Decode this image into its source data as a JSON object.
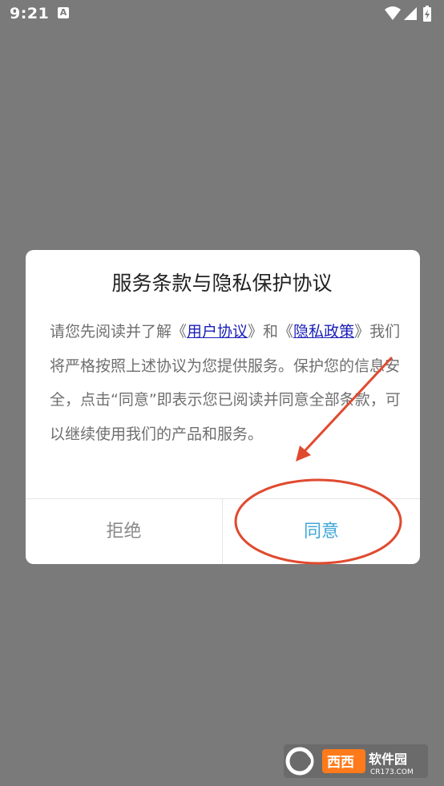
{
  "status_bar": {
    "time": "9:21",
    "notification_icon": "a-icon",
    "wifi_icon": "wifi-icon",
    "signal_icon": "signal-icon",
    "battery_icon": "battery-charging-icon"
  },
  "dialog": {
    "title": "服务条款与隐私保护协议",
    "body": {
      "text_1": "请您先阅读并了解《",
      "link_user_agreement": "用户协议",
      "text_2": "》和《",
      "link_privacy_policy_line1": "隐私政",
      "link_privacy_policy_line2": "策",
      "text_3": "》我们将严格按照上述协议为您提供服务。保护您的信息安全，点击“同意”即表示您已阅读并同意全部条款，可以继续使用我们的产品和服务。"
    },
    "buttons": {
      "refuse": "拒绝",
      "agree": "同意"
    }
  },
  "colors": {
    "backdrop": "#7a7a7a",
    "dialog_bg": "#ffffff",
    "title": "#222222",
    "body_text": "#6f6f6f",
    "link": "#1a1fb8",
    "refuse_button": "#8a8a8a",
    "agree_button": "#41a6d8",
    "annotation": "#e04a2f"
  },
  "watermark": {
    "logo_text": "西西软件园",
    "url": "CR173.COM"
  }
}
